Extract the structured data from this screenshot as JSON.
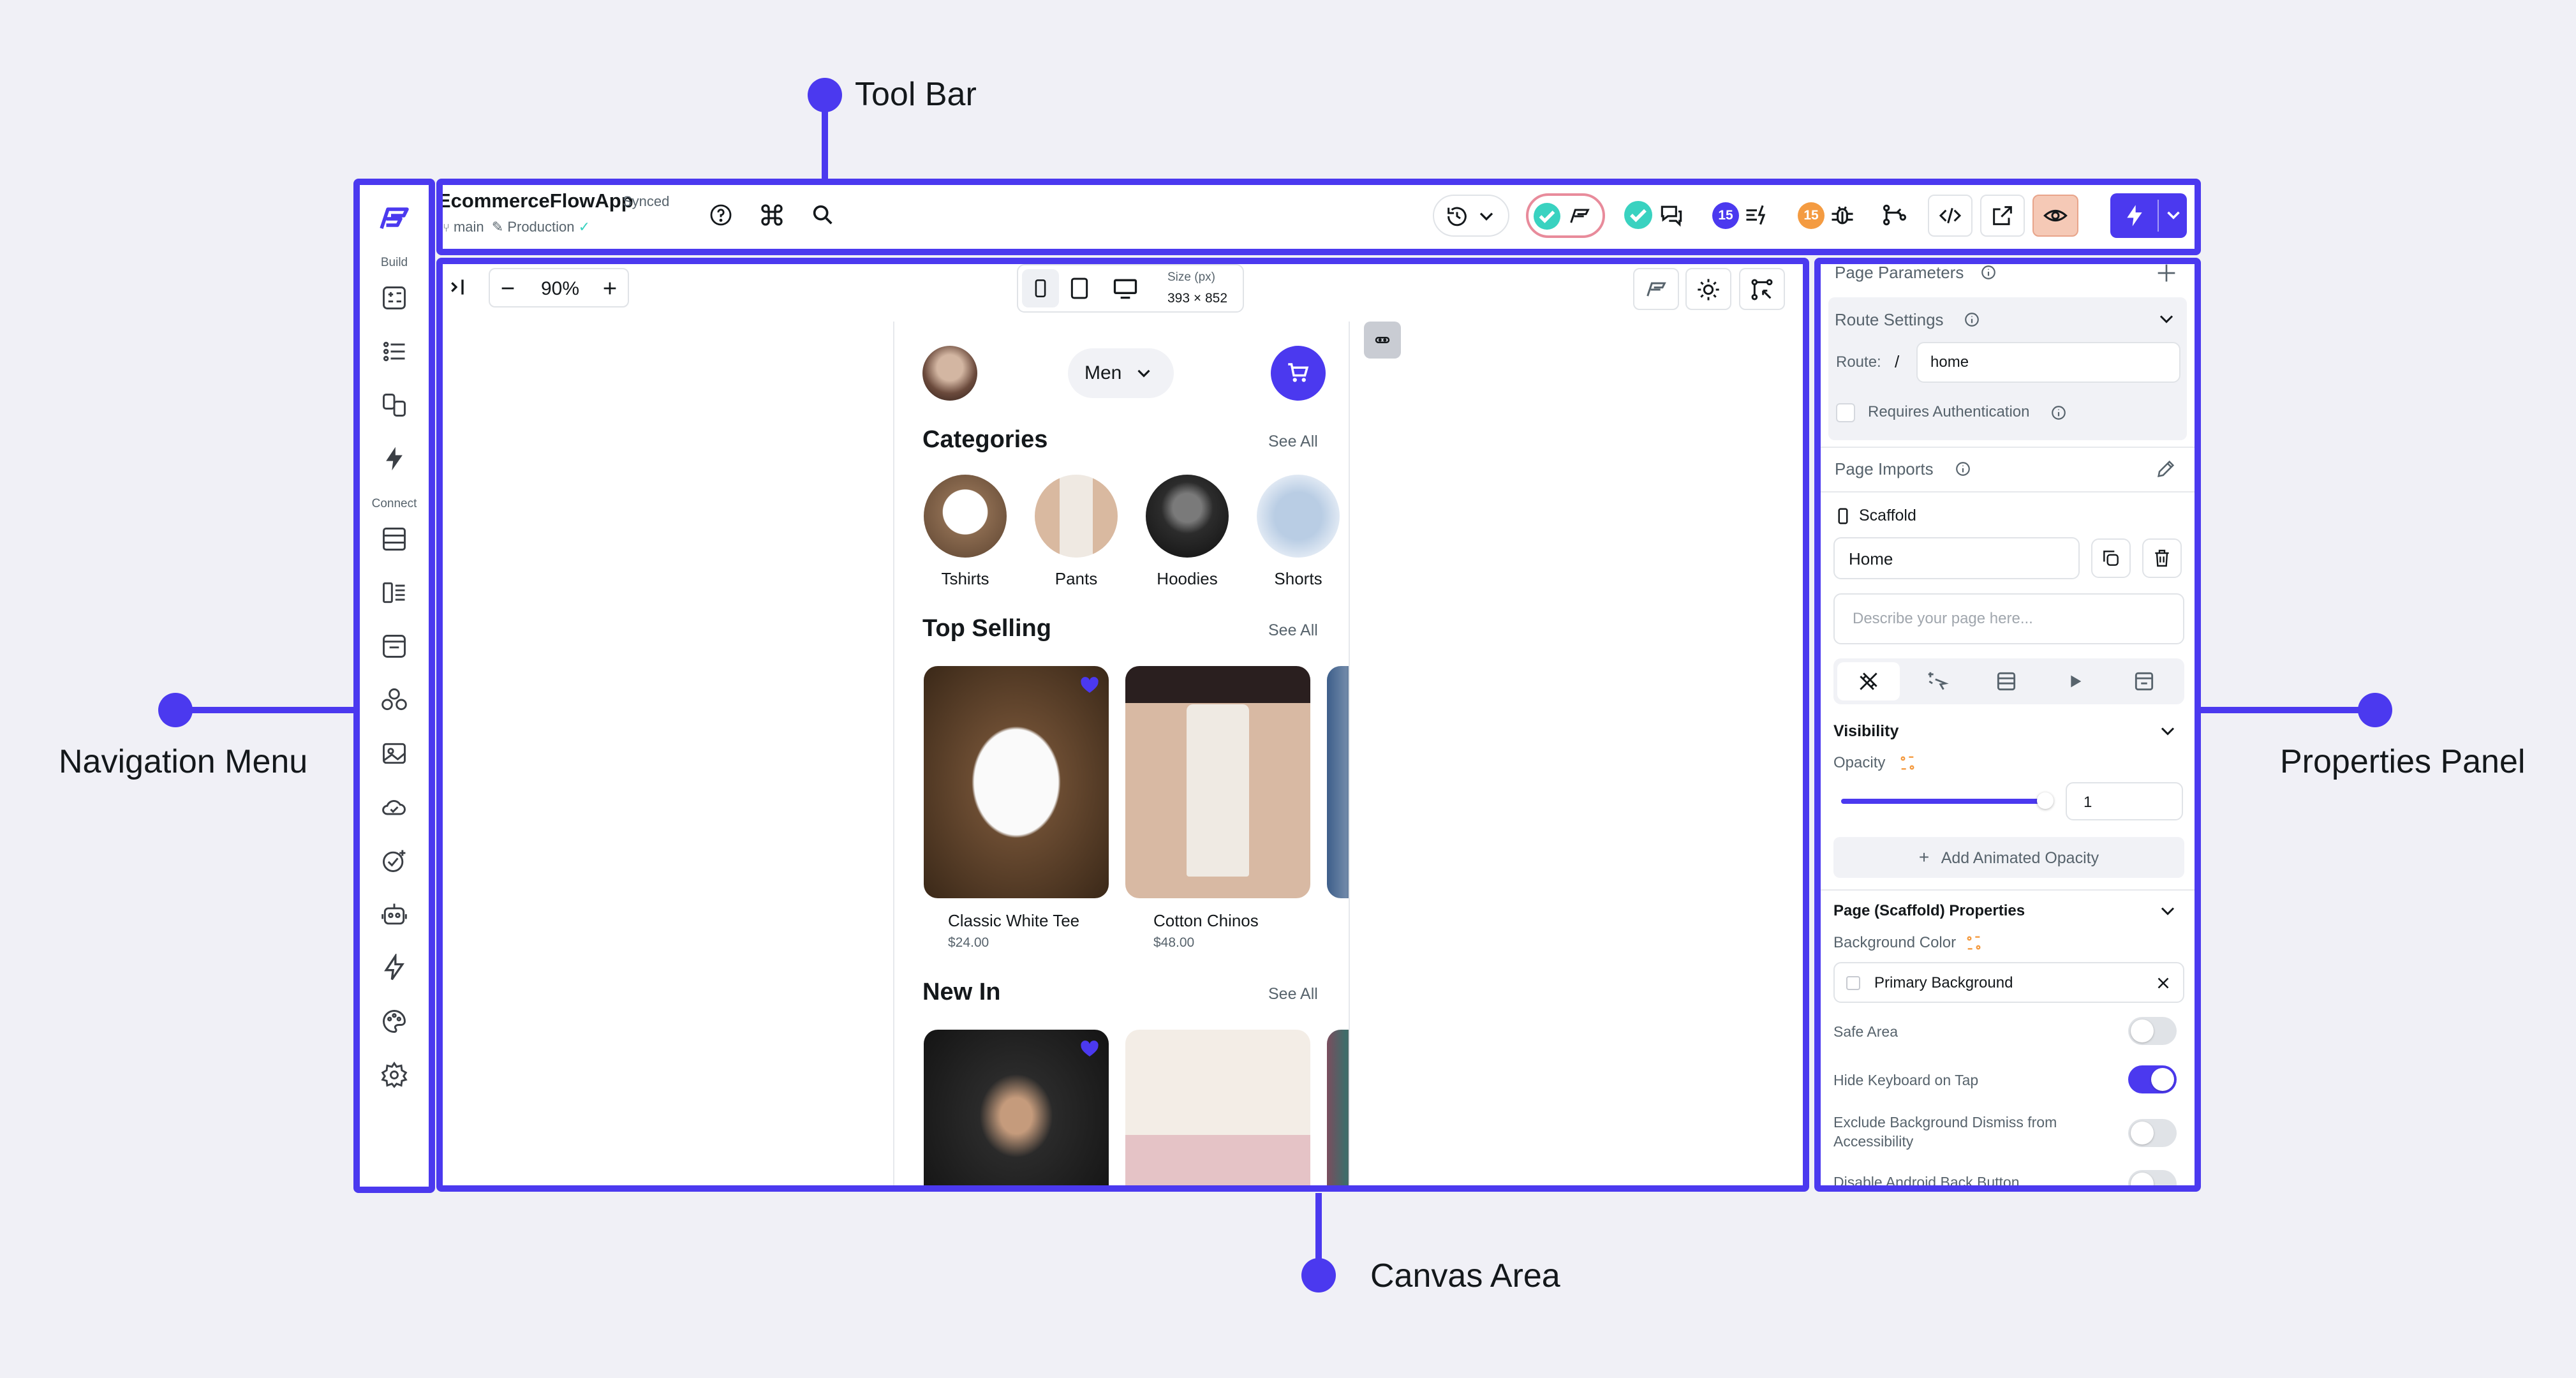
{
  "callouts": {
    "toolbar": "Tool Bar",
    "navigation": "Navigation Menu",
    "properties": "Properties Panel",
    "canvas": "Canvas Area"
  },
  "colors": {
    "accent": "#4B39EF",
    "background": "#F0F0F6",
    "preview_button": "#F5C9B6"
  },
  "project": {
    "name": "EcommerceFlowApp",
    "status": "Synced",
    "branch": "main",
    "environment": "Production"
  },
  "toolbar": {
    "badge_agent": "15",
    "badge_debug": "15"
  },
  "nav": {
    "section_build": "Build",
    "section_connect": "Connect"
  },
  "canvas": {
    "zoom": "90%",
    "size_label": "Size (px)",
    "size_value": "393 × 852",
    "gender_select": "Men",
    "categories_title": "Categories",
    "see_all": "See All",
    "categories": [
      "Tshirts",
      "Pants",
      "Hoodies",
      "Shorts"
    ],
    "top_selling_title": "Top Selling",
    "products": [
      {
        "name": "Classic White Tee",
        "price": "$24.00"
      },
      {
        "name": "Cotton Chinos",
        "price": "$48.00"
      }
    ],
    "new_in_title": "New In"
  },
  "properties": {
    "page_parameters": "Page Parameters",
    "route_settings": "Route Settings",
    "route_label": "Route:",
    "route_slash": "/",
    "route_value": "home",
    "requires_auth": "Requires Authentication",
    "page_imports": "Page Imports",
    "scaffold": "Scaffold",
    "page_name": "Home",
    "describe_placeholder": "Describe your page here...",
    "visibility": "Visibility",
    "opacity": "Opacity",
    "opacity_value": "1",
    "opacity_level": 1.0,
    "add_animated_opacity": "Add Animated Opacity",
    "scaffold_properties": "Page (Scaffold) Properties",
    "background_color": "Background Color",
    "background_value": "Primary Background",
    "safe_area": "Safe Area",
    "hide_keyboard": "Hide Keyboard on Tap",
    "exclude_bg": "Exclude Background Dismiss from Accessibility",
    "disable_back": "Disable Android Back Button"
  }
}
